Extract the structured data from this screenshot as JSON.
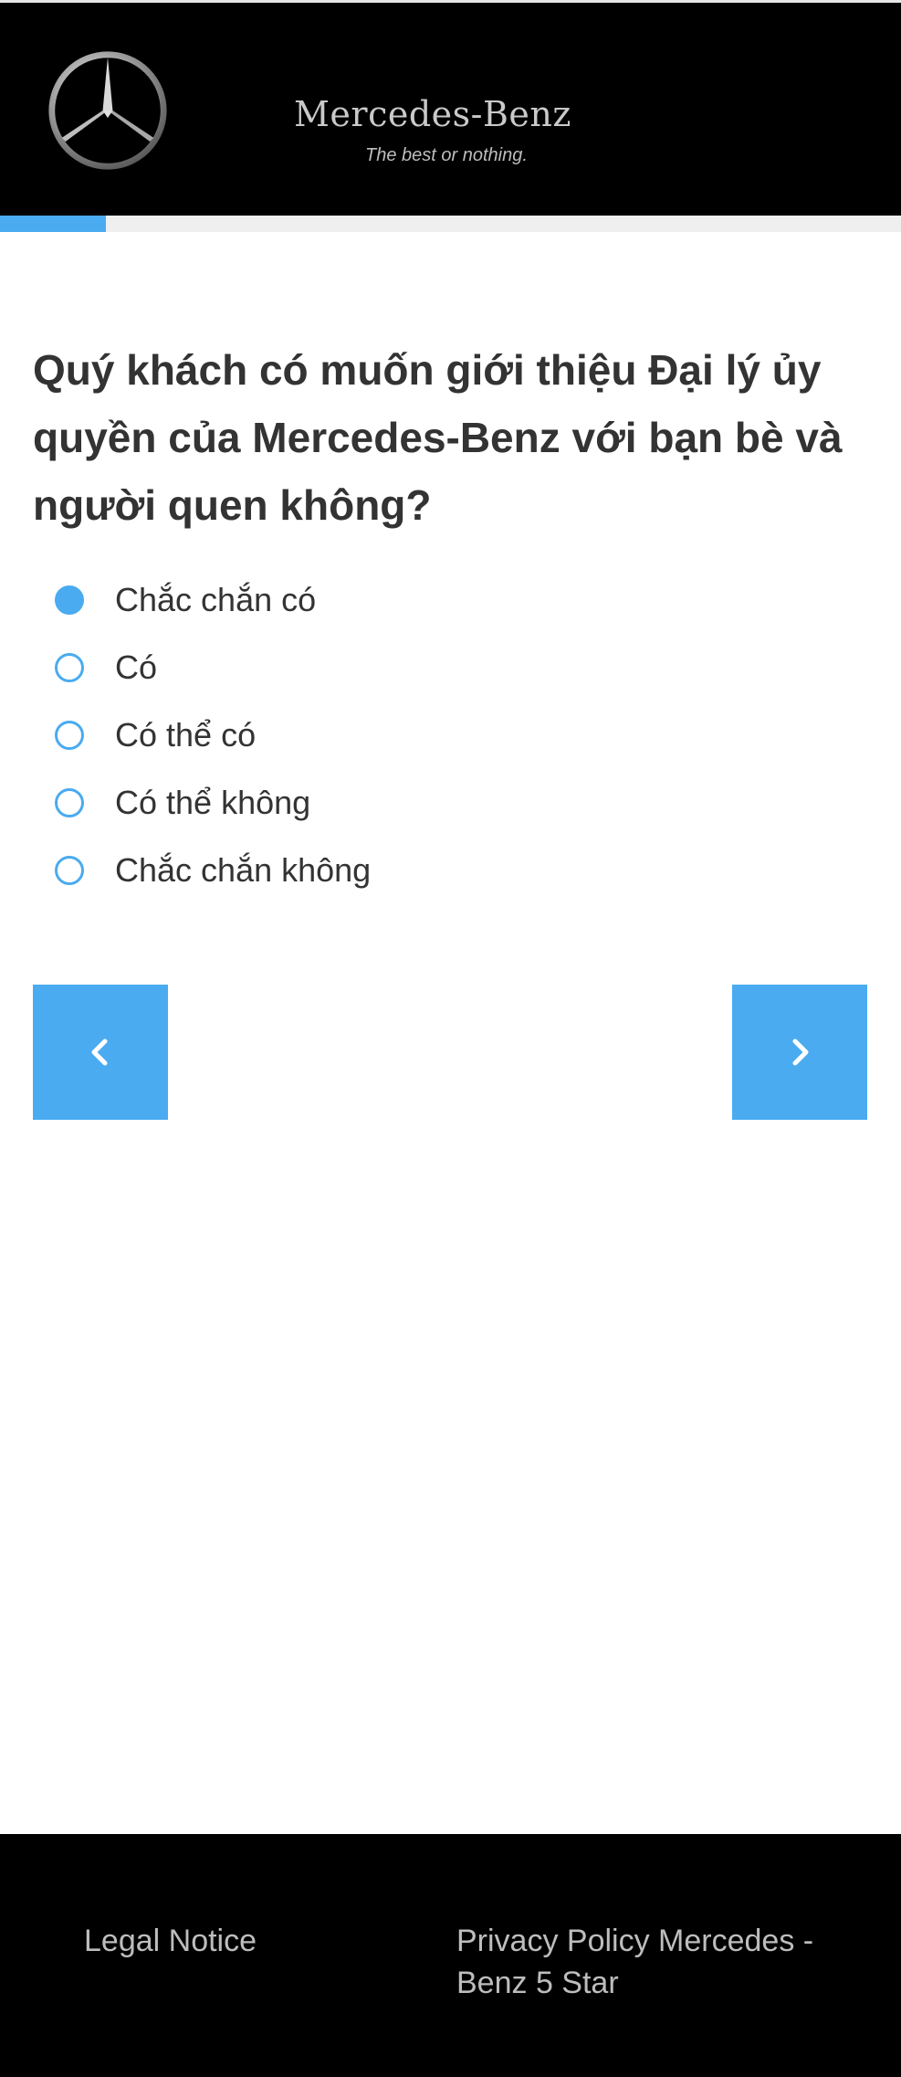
{
  "header": {
    "brand_name": "Mercedes-Benz",
    "tagline": "The best or nothing.",
    "logo_icon": "mercedes-star-icon"
  },
  "progress": {
    "fraction": 0.118,
    "fill_color": "#4aabf0",
    "track_color": "#efefef"
  },
  "question": {
    "text": "Quý khách có muốn giới thiệu Đại lý ủy quyền của Mercedes-Benz với bạn bè và người quen không?"
  },
  "options": [
    {
      "label": "Chắc chắn có",
      "selected": true
    },
    {
      "label": "Có",
      "selected": false
    },
    {
      "label": "Có thể có",
      "selected": false
    },
    {
      "label": "Có thể không",
      "selected": false
    },
    {
      "label": "Chắc chắn không",
      "selected": false
    }
  ],
  "navigation": {
    "prev_icon": "chevron-left-icon",
    "next_icon": "chevron-right-icon"
  },
  "footer": {
    "legal_notice": "Legal Notice",
    "privacy_policy": "Privacy Policy Mercedes - Benz 5 Star"
  },
  "colors": {
    "accent": "#4aabf0",
    "header_bg": "#000000",
    "footer_bg": "#000000",
    "text": "#333333"
  }
}
